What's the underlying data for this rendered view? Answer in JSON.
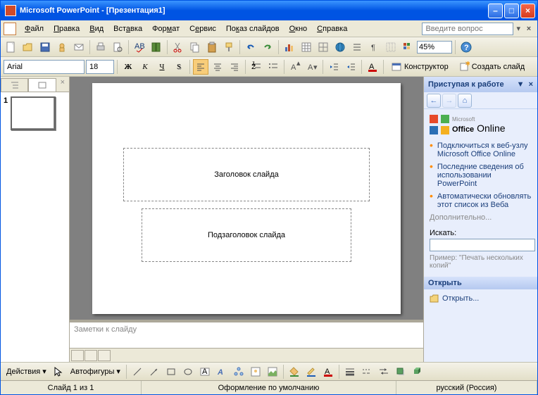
{
  "title": "Microsoft PowerPoint - [Презентация1]",
  "menu": {
    "file": "Файл",
    "edit": "Правка",
    "view": "Вид",
    "insert": "Вставка",
    "format": "Формат",
    "service": "Сервис",
    "slideshow": "Показ слайдов",
    "window": "Окно",
    "help": "Справка"
  },
  "help_placeholder": "Введите вопрос",
  "zoom": "45%",
  "font": {
    "name": "Arial",
    "size": "18"
  },
  "fmt_toolbar": {
    "designer": "Конструктор",
    "new_slide": "Создать слайд"
  },
  "thumb": {
    "num": "1"
  },
  "slide": {
    "title": "Заголовок слайда",
    "subtitle": "Подзаголовок слайда"
  },
  "notes_placeholder": "Заметки к слайду",
  "taskpane": {
    "header": "Приступая к работе",
    "office": "Office Online",
    "office_prefix": "Microsoft",
    "links": [
      "Подключиться к веб-узлу Microsoft Office Online",
      "Последние сведения об использовании PowerPoint",
      "Автоматически обновлять этот список из Веба"
    ],
    "more": "Дополнительно...",
    "search_label": "Искать:",
    "example": "Пример: \"Печать нескольких копий\"",
    "open_header": "Открыть",
    "open_link": "Открыть..."
  },
  "drawbar": {
    "actions": "Действия",
    "autoshapes": "Автофигуры"
  },
  "status": {
    "slide": "Слайд 1 из 1",
    "design": "Оформление по умолчанию",
    "lang": "русский (Россия)"
  }
}
